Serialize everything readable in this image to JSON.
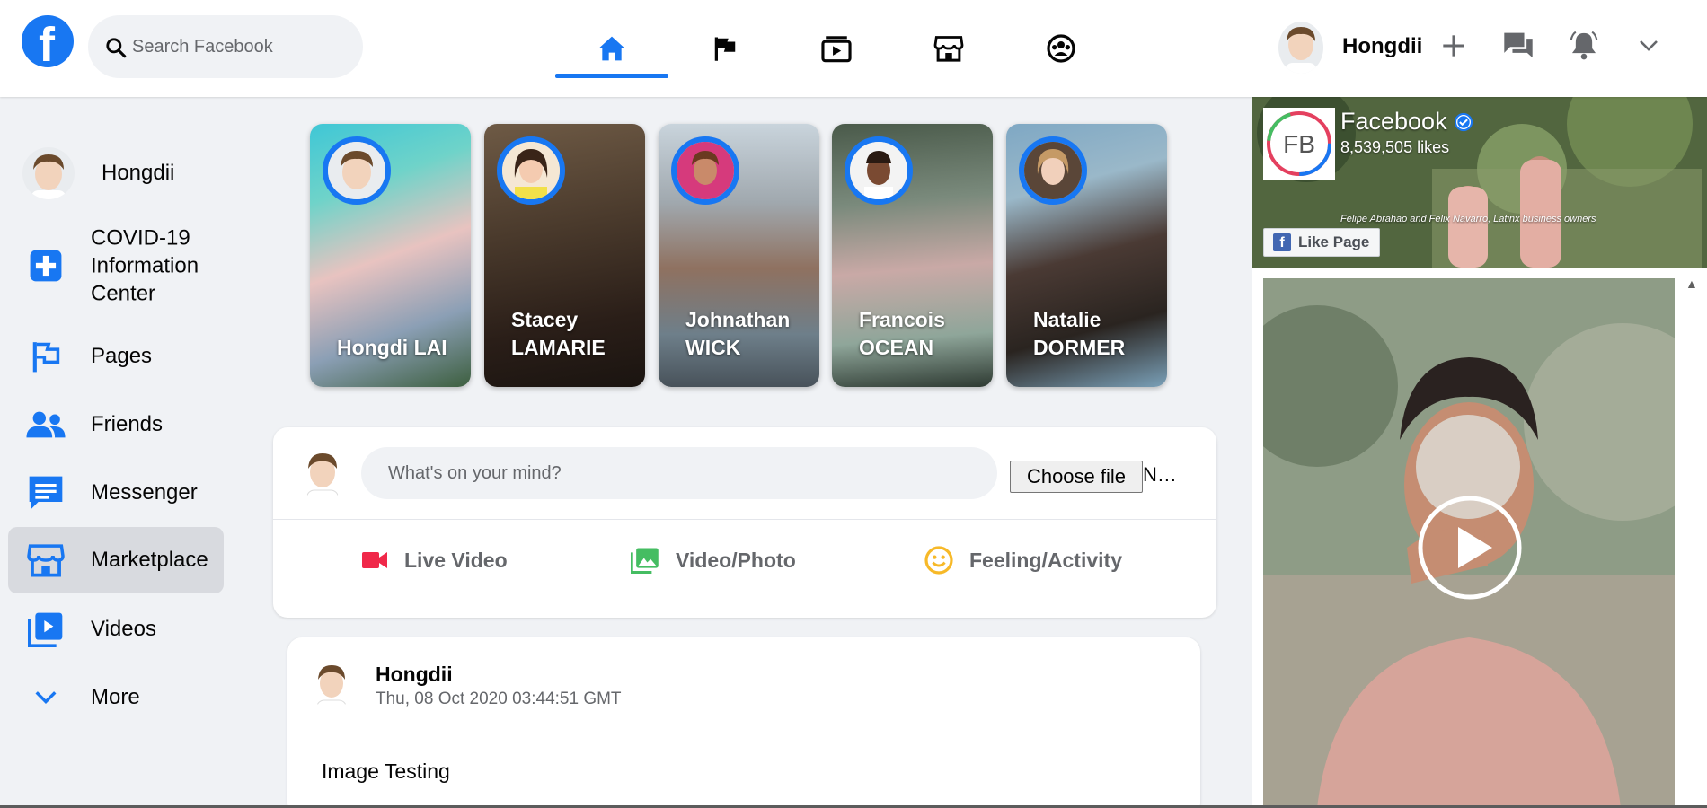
{
  "header": {
    "search_placeholder": "Search Facebook",
    "user_name": "Hongdii",
    "nav_tabs": [
      "home-icon",
      "flag-icon",
      "watch-icon",
      "marketplace-icon",
      "groups-icon"
    ],
    "active_tab": "home-icon",
    "accent_color": "#1877f2"
  },
  "sidebar": {
    "profile_name": "Hongdii",
    "items": [
      {
        "label": "COVID-19 Information Center",
        "icon": "covid-info-icon"
      },
      {
        "label": "Pages",
        "icon": "pages-flag-icon"
      },
      {
        "label": "Friends",
        "icon": "friends-icon"
      },
      {
        "label": "Messenger",
        "icon": "messenger-icon"
      },
      {
        "label": "Marketplace",
        "icon": "marketplace-icon",
        "active": true
      },
      {
        "label": "Videos",
        "icon": "videos-icon"
      },
      {
        "label": "More",
        "icon": "chevron-down-icon"
      }
    ]
  },
  "stories": [
    {
      "first": "Hongdi LAI",
      "last": ""
    },
    {
      "first": "Stacey",
      "last": "LAMARIE"
    },
    {
      "first": "Johnathan",
      "last": "WICK"
    },
    {
      "first": "Francois",
      "last": "OCEAN"
    },
    {
      "first": "Natalie",
      "last": "DORMER"
    }
  ],
  "composer": {
    "placeholder": "What's on your mind?",
    "choose_file_label": "Choose file",
    "no_file_text": "N…",
    "actions": [
      {
        "label": "Live Video",
        "icon": "live-video-icon",
        "color": "#f02849"
      },
      {
        "label": "Video/Photo",
        "icon": "photo-icon",
        "color": "#45bd62"
      },
      {
        "label": "Feeling/Activity",
        "icon": "smiley-icon",
        "color": "#f7b928"
      }
    ]
  },
  "post": {
    "author": "Hongdii",
    "timestamp": "Thu, 08 Oct 2020 03:44:51 GMT",
    "text": "Image Testing"
  },
  "page_plugin": {
    "logo_text": "FB",
    "title": "Facebook",
    "likes": "8,539,505 likes",
    "caption": "Felipe Abrahao and Felix Navarro, Latinx business owners",
    "like_button": "Like Page"
  }
}
